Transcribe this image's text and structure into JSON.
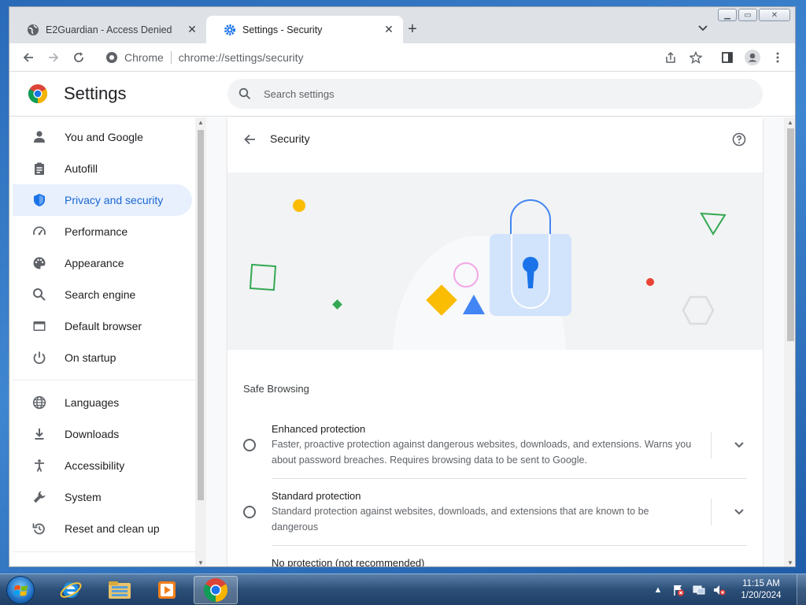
{
  "tabs": [
    {
      "title": "E2Guardian - Access Denied",
      "icon": "globe-icon"
    },
    {
      "title": "Settings - Security",
      "icon": "gear-icon",
      "active": true
    }
  ],
  "omnibox": {
    "site_name": "Chrome",
    "url": "chrome://settings/security"
  },
  "settings": {
    "title": "Settings",
    "search_placeholder": "Search settings"
  },
  "sidebar": {
    "items": [
      {
        "label": "You and Google",
        "icon": "person-icon"
      },
      {
        "label": "Autofill",
        "icon": "clipboard-icon"
      },
      {
        "label": "Privacy and security",
        "icon": "shield-icon",
        "selected": true
      },
      {
        "label": "Performance",
        "icon": "speedometer-icon"
      },
      {
        "label": "Appearance",
        "icon": "palette-icon"
      },
      {
        "label": "Search engine",
        "icon": "search-icon"
      },
      {
        "label": "Default browser",
        "icon": "browser-icon"
      },
      {
        "label": "On startup",
        "icon": "power-icon"
      },
      {
        "label": "Languages",
        "icon": "globe-icon"
      },
      {
        "label": "Downloads",
        "icon": "download-icon"
      },
      {
        "label": "Accessibility",
        "icon": "accessibility-icon"
      },
      {
        "label": "System",
        "icon": "wrench-icon"
      },
      {
        "label": "Reset and clean up",
        "icon": "reset-icon"
      }
    ]
  },
  "security": {
    "title": "Security",
    "section_title": "Safe Browsing",
    "options": [
      {
        "title": "Enhanced protection",
        "desc": "Faster, proactive protection against dangerous websites, downloads, and extensions. Warns you about password breaches. Requires browsing data to be sent to Google."
      },
      {
        "title": "Standard protection",
        "desc": "Standard protection against websites, downloads, and extensions that are known to be dangerous"
      },
      {
        "title": "No protection (not recommended)",
        "desc": ""
      }
    ]
  },
  "taskbar": {
    "time": "11:15 AM",
    "date": "1/20/2024",
    "apps": [
      "ie-icon",
      "explorer-icon",
      "media-player-icon",
      "chrome-icon"
    ]
  },
  "colors": {
    "accent": "#1a73e8",
    "selected_bg": "#e8f0fe",
    "selected_text": "#1967d2"
  }
}
